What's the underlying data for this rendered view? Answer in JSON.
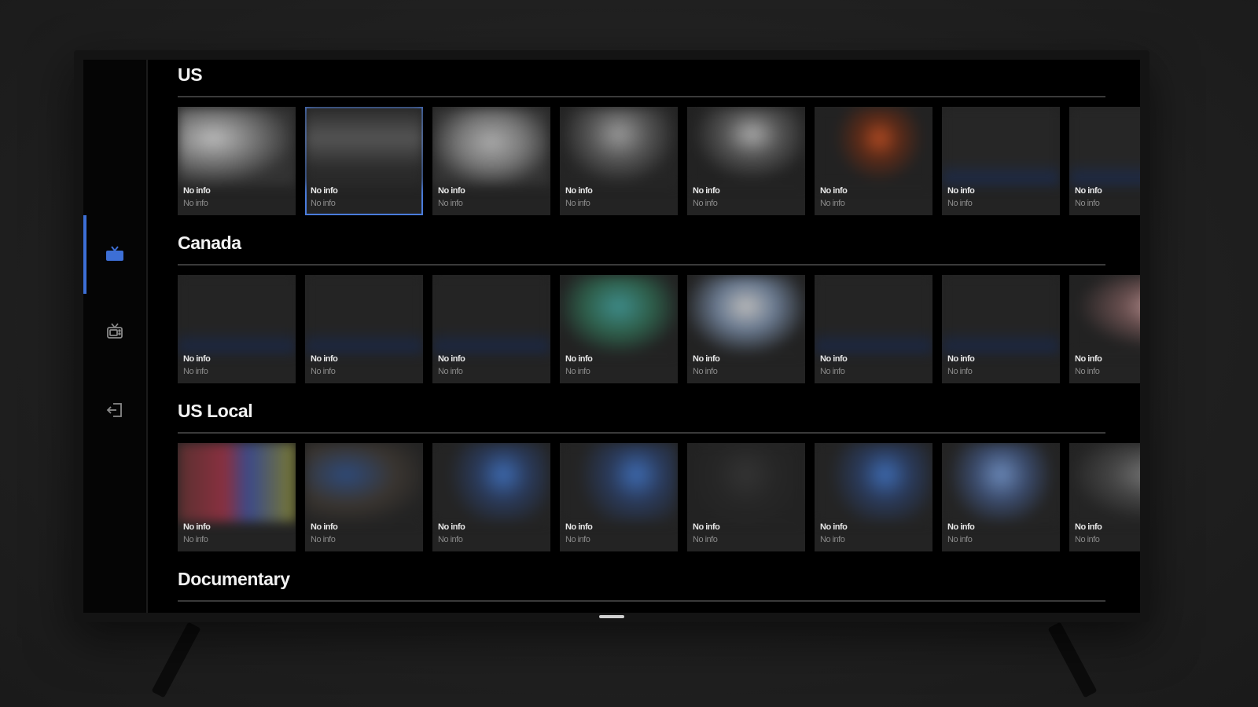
{
  "sidebar": {
    "items": [
      {
        "name": "live-tv",
        "icon": "tv-icon",
        "active": true,
        "accent": "#3d6fd6"
      },
      {
        "name": "guide",
        "icon": "retro-tv-icon",
        "active": false
      },
      {
        "name": "logout",
        "icon": "exit-icon",
        "active": false
      }
    ]
  },
  "sections": [
    {
      "title": "US",
      "cards": [
        {
          "title": "No info",
          "subtitle": "No info"
        },
        {
          "title": "No info",
          "subtitle": "No info"
        },
        {
          "title": "No info",
          "subtitle": "No info"
        },
        {
          "title": "No info",
          "subtitle": "No info"
        },
        {
          "title": "No info",
          "subtitle": "No info"
        },
        {
          "title": "No info",
          "subtitle": "No info"
        },
        {
          "title": "No info",
          "subtitle": "No info"
        },
        {
          "title": "No info",
          "subtitle": "No info"
        }
      ]
    },
    {
      "title": "Canada",
      "cards": [
        {
          "title": "No info",
          "subtitle": "No info"
        },
        {
          "title": "No info",
          "subtitle": "No info"
        },
        {
          "title": "No info",
          "subtitle": "No info"
        },
        {
          "title": "No info",
          "subtitle": "No info"
        },
        {
          "title": "No info",
          "subtitle": "No info"
        },
        {
          "title": "No info",
          "subtitle": "No info"
        },
        {
          "title": "No info",
          "subtitle": "No info"
        },
        {
          "title": "No info",
          "subtitle": "No info"
        }
      ]
    },
    {
      "title": "US Local",
      "cards": [
        {
          "title": "No info",
          "subtitle": "No info"
        },
        {
          "title": "No info",
          "subtitle": "No info"
        },
        {
          "title": "No info",
          "subtitle": "No info"
        },
        {
          "title": "No info",
          "subtitle": "No info"
        },
        {
          "title": "No info",
          "subtitle": "No info"
        },
        {
          "title": "No info",
          "subtitle": "No info"
        },
        {
          "title": "No info",
          "subtitle": "No info"
        },
        {
          "title": "No info",
          "subtitle": "No info"
        }
      ]
    },
    {
      "title": "Documentary",
      "cards": []
    }
  ],
  "selected": {
    "section": 0,
    "card": 1
  },
  "colors": {
    "accent": "#3d6fd6",
    "selection": "#4a7cdc",
    "card": "#232323",
    "background": "#000000"
  }
}
